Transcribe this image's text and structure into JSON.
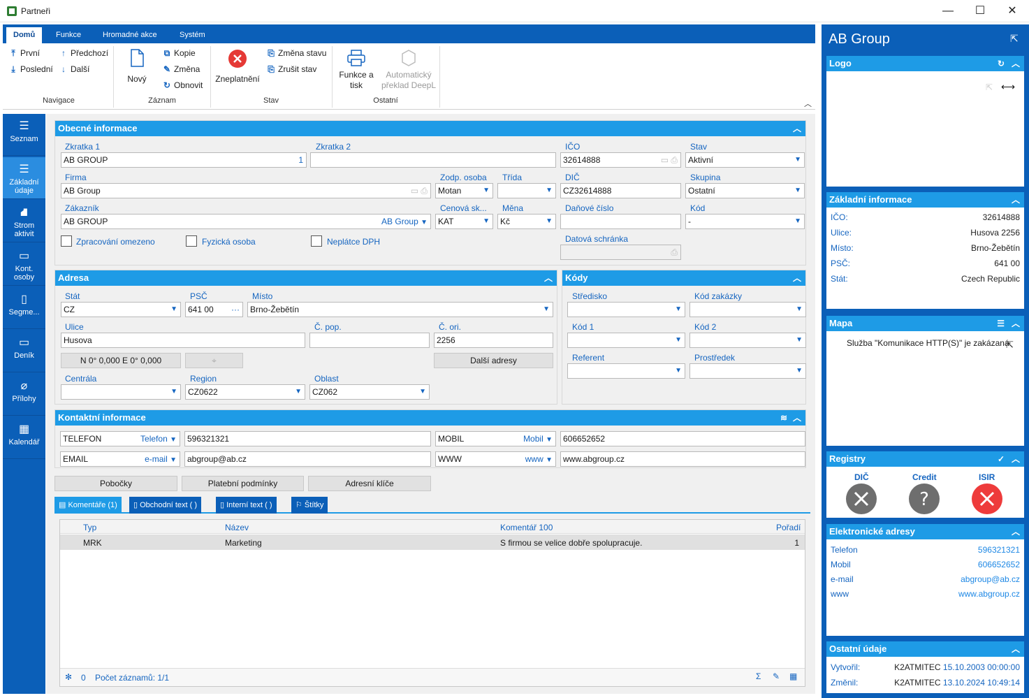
{
  "window": {
    "title": "Partneři",
    "minimize": "—",
    "maximize": "☐",
    "close": "✕"
  },
  "ribbon": {
    "tabs": [
      "Domů",
      "Funkce",
      "Hromadné akce",
      "Systém"
    ],
    "nav": {
      "first": "První",
      "last": "Poslední",
      "prev": "Předchozí",
      "next": "Další",
      "group": "Navigace"
    },
    "record": {
      "new": "Nový",
      "copy": "Kopie",
      "change": "Změna",
      "refresh": "Obnovit",
      "group": "Záznam"
    },
    "state": {
      "invalidate": "Zneplatnění",
      "change_state": "Změna stavu",
      "cancel_state": "Zrušit stav",
      "group": "Stav"
    },
    "other": {
      "print_1": "Funkce a",
      "print_2": "tisk",
      "deepl_1": "Automatický",
      "deepl_2": "překlad DeepL",
      "group": "Ostatní"
    }
  },
  "leftnav": [
    {
      "label1": "Seznam",
      "label2": ""
    },
    {
      "label1": "Základní",
      "label2": "údaje"
    },
    {
      "label1": "Strom",
      "label2": "aktivit"
    },
    {
      "label1": "Kont.",
      "label2": "osoby"
    },
    {
      "label1": "Segme...",
      "label2": ""
    },
    {
      "label1": "Deník",
      "label2": ""
    },
    {
      "label1": "Přílohy",
      "label2": ""
    },
    {
      "label1": "Kalendář",
      "label2": ""
    }
  ],
  "general": {
    "title": "Obecné informace",
    "zkratka1_label": "Zkratka 1",
    "zkratka1": "AB GROUP",
    "zkratka1_num": "1",
    "zkratka2_label": "Zkratka 2",
    "zkratka2": "",
    "ico_label": "IČO",
    "ico": "32614888",
    "stav_label": "Stav",
    "stav": "Aktivní",
    "firma_label": "Firma",
    "firma": "AB Group",
    "zodp_label": "Zodp. osoba",
    "zodp": "Motan",
    "trida_label": "Třída",
    "trida": "",
    "dic_label": "DIČ",
    "dic": "CZ32614888",
    "skupina_label": "Skupina",
    "skupina": "Ostatní",
    "zakaznik_label": "Zákazník",
    "zakaznik": "AB GROUP",
    "zakaznik_link": "AB Group",
    "cenova_label": "Cenová sk...",
    "cenova": "KAT",
    "mena_label": "Měna",
    "mena": "Kč",
    "danove_label": "Daňové číslo",
    "danove": "",
    "kod_label": "Kód",
    "kod": "-",
    "cb1": "Zpracování omezeno",
    "cb2": "Fyzická osoba",
    "cb3": "Neplátce DPH",
    "datova_label": "Datová schránka",
    "datova": ""
  },
  "address": {
    "title": "Adresa",
    "stat_label": "Stát",
    "stat": "CZ",
    "psc_label": "PSČ",
    "psc": "641 00",
    "misto_label": "Místo",
    "misto": "Brno-Žebětín",
    "ulice_label": "Ulice",
    "ulice": "Husova",
    "cpop_label": "Č. pop.",
    "cpop": "",
    "cori_label": "Č. ori.",
    "cori": "2256",
    "gps": "N 0° 0,000 E 0° 0,000",
    "more": "Další adresy",
    "centrala_label": "Centrála",
    "centrala": "",
    "region_label": "Region",
    "region": "CZ0622",
    "oblast_label": "Oblast",
    "oblast": "CZ062"
  },
  "codes": {
    "title": "Kódy",
    "stredisko": "Středisko",
    "kod_zakazky": "Kód zakázky",
    "kod1": "Kód 1",
    "kod2": "Kód 2",
    "referent": "Referent",
    "prostredek": "Prostředek"
  },
  "contact": {
    "title": "Kontaktní informace",
    "rows": [
      {
        "name1": "TELEFON",
        "type1": "Telefon",
        "val1": "596321321",
        "name2": "MOBIL",
        "type2": "Mobil",
        "val2": "606652652"
      },
      {
        "name1": "EMAIL",
        "type1": "e-mail",
        "val1": "abgroup@ab.cz",
        "name2": "WWW",
        "type2": "www",
        "val2": "www.abgroup.cz"
      }
    ]
  },
  "buttons": {
    "branches": "Pobočky",
    "payment": "Platební podmínky",
    "keys": "Adresní klíče"
  },
  "bottom_tabs": [
    "Komentáře (1)",
    "Obchodní text ( )",
    "Interní text ( )",
    "Štítky"
  ],
  "grid": {
    "headers": [
      "Typ",
      "Název",
      "Komentář 100",
      "Pořadí"
    ],
    "rows": [
      [
        "MRK",
        "Marketing",
        "S firmou se velice dobře spolupracuje.",
        "1"
      ]
    ],
    "footer_count": "0",
    "footer_records": "Počet záznamů: 1/1"
  },
  "right": {
    "company": "AB Group",
    "logo_title": "Logo",
    "basic_title": "Základní informace",
    "basic": [
      {
        "k": "IČO:",
        "v": "32614888"
      },
      {
        "k": "Ulice:",
        "v": "Husova 2256"
      },
      {
        "k": "Místo:",
        "v": "Brno-Žebětín"
      },
      {
        "k": "PSČ:",
        "v": "641 00"
      },
      {
        "k": "Stát:",
        "v": "Czech Republic"
      }
    ],
    "map_title": "Mapa",
    "map_msg": "Služba \"Komunikace HTTP(S)\" je zakázaná",
    "registry_title": "Registry",
    "registry": [
      "DIČ",
      "Credit",
      "ISIR"
    ],
    "eaddr_title": "Elektronické adresy",
    "eaddr": [
      {
        "k": "Telefon",
        "v": "596321321"
      },
      {
        "k": "Mobil",
        "v": "606652652"
      },
      {
        "k": "e-mail",
        "v": "abgroup@ab.cz"
      },
      {
        "k": "www",
        "v": "www.abgroup.cz"
      }
    ],
    "other_title": "Ostatní údaje",
    "other": [
      {
        "k": "Vytvořil:",
        "user": "K2ATMITEC",
        "v": "15.10.2003 00:00:00"
      },
      {
        "k": "Změnil:",
        "user": "K2ATMITEC",
        "v": "13.10.2024 10:49:14"
      }
    ]
  }
}
